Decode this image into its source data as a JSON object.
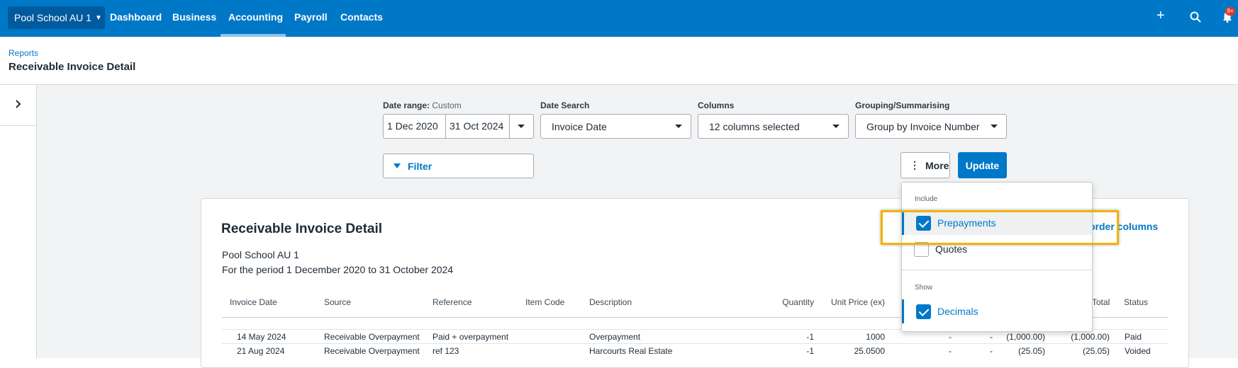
{
  "nav": {
    "org": "Pool School AU 1",
    "items": [
      "Dashboard",
      "Business",
      "Accounting",
      "Payroll",
      "Contacts"
    ],
    "active": "Accounting",
    "icons": [
      "plus-icon",
      "search-icon",
      "bell-icon"
    ],
    "notification_count": "9+"
  },
  "header": {
    "breadcrumb": "Reports",
    "title": "Receivable Invoice Detail"
  },
  "controls": {
    "date_range_label": "Date range:",
    "date_range_sub": "Custom",
    "date_from": "1 Dec 2020",
    "date_to": "31 Oct 2024",
    "date_search_label": "Date Search",
    "date_search_value": "Invoice Date",
    "columns_label": "Columns",
    "columns_value": "12 columns selected",
    "grouping_label": "Grouping/Summarising",
    "grouping_value": "Group by Invoice Number",
    "filter_label": "Filter",
    "more_label": "More",
    "update_label": "Update"
  },
  "report": {
    "title": "Receivable Invoice Detail",
    "org": "Pool School AU 1",
    "period": "For the period 1 December 2020 to 31 October 2024",
    "reorder_link": "order columns",
    "headers": [
      "Invoice Date",
      "Source",
      "Reference",
      "Item Code",
      "Description",
      "Quantity",
      "Unit Price (ex)",
      "Total",
      "Status"
    ],
    "rows": [
      {
        "date": "14 May 2024",
        "source": "Receivable Overpayment",
        "reference": "Paid + overpayment",
        "item_code": "",
        "description": "Overpayment",
        "quantity": "-1",
        "unit_price": "1000",
        "dash1": "-",
        "dash2": "-",
        "amount": "(1,000.00)",
        "total": "(1,000.00)",
        "status": "Paid"
      },
      {
        "date": "21 Aug 2024",
        "source": "Receivable Overpayment",
        "reference": "ref 123",
        "item_code": "",
        "description": "Harcourts Real Estate",
        "quantity": "-1",
        "unit_price": "25.0500",
        "dash1": "-",
        "dash2": "-",
        "amount": "(25.05)",
        "total": "(25.05)",
        "status": "Voided"
      }
    ]
  },
  "menu": {
    "include_label": "Include",
    "show_label": "Show",
    "items": [
      {
        "label": "Prepayments",
        "checked": true
      },
      {
        "label": "Quotes",
        "checked": false
      },
      {
        "label": "Decimals",
        "checked": true
      }
    ]
  },
  "colors": {
    "brand_blue": "#0078c8",
    "highlight": "#f0b400"
  }
}
